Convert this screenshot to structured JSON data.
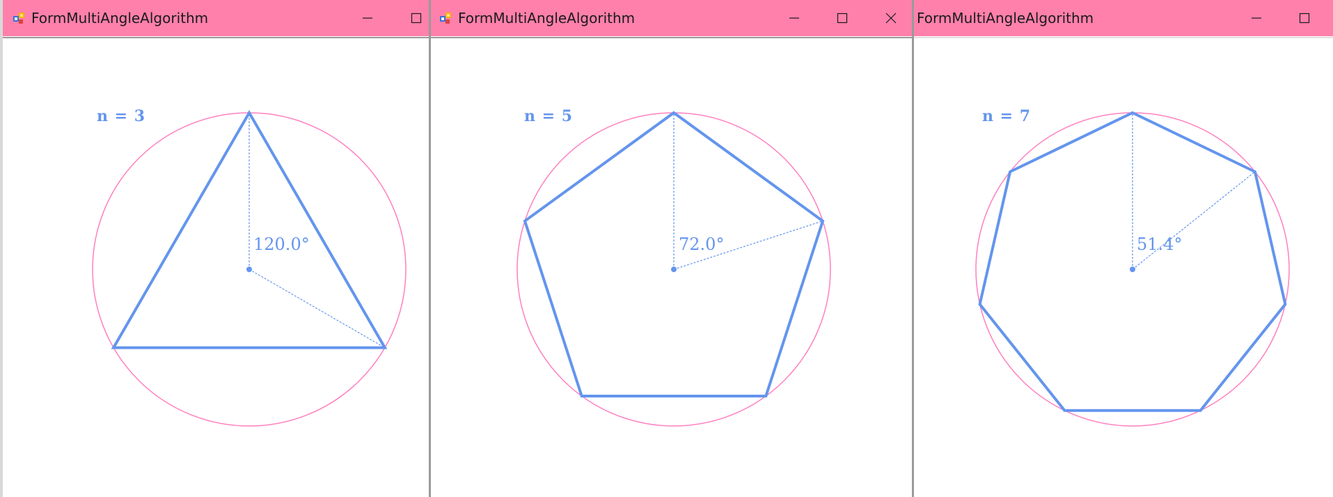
{
  "colors": {
    "titlebar": "#ff80ab",
    "circle": "#ff80bf",
    "polygon": "#6495ed",
    "client": "#ffffff"
  },
  "icons": {
    "app": "app-icon",
    "minimize": "minimize-icon",
    "maximize": "maximize-icon",
    "close": "close-icon"
  },
  "windows": [
    {
      "title": "FormMultiAngleAlgorithm",
      "n_label": "n = 3",
      "angle_label": "120.0°",
      "n": 3,
      "show_icon": true,
      "show_close": false
    },
    {
      "title": "FormMultiAngleAlgorithm",
      "n_label": "n = 5",
      "angle_label": "72.0°",
      "n": 5,
      "show_icon": true,
      "show_close": true
    },
    {
      "title": "FormMultiAngleAlgorithm",
      "n_label": "n = 7",
      "angle_label": "51.4°",
      "n": 7,
      "show_icon": false,
      "show_close": false
    }
  ]
}
